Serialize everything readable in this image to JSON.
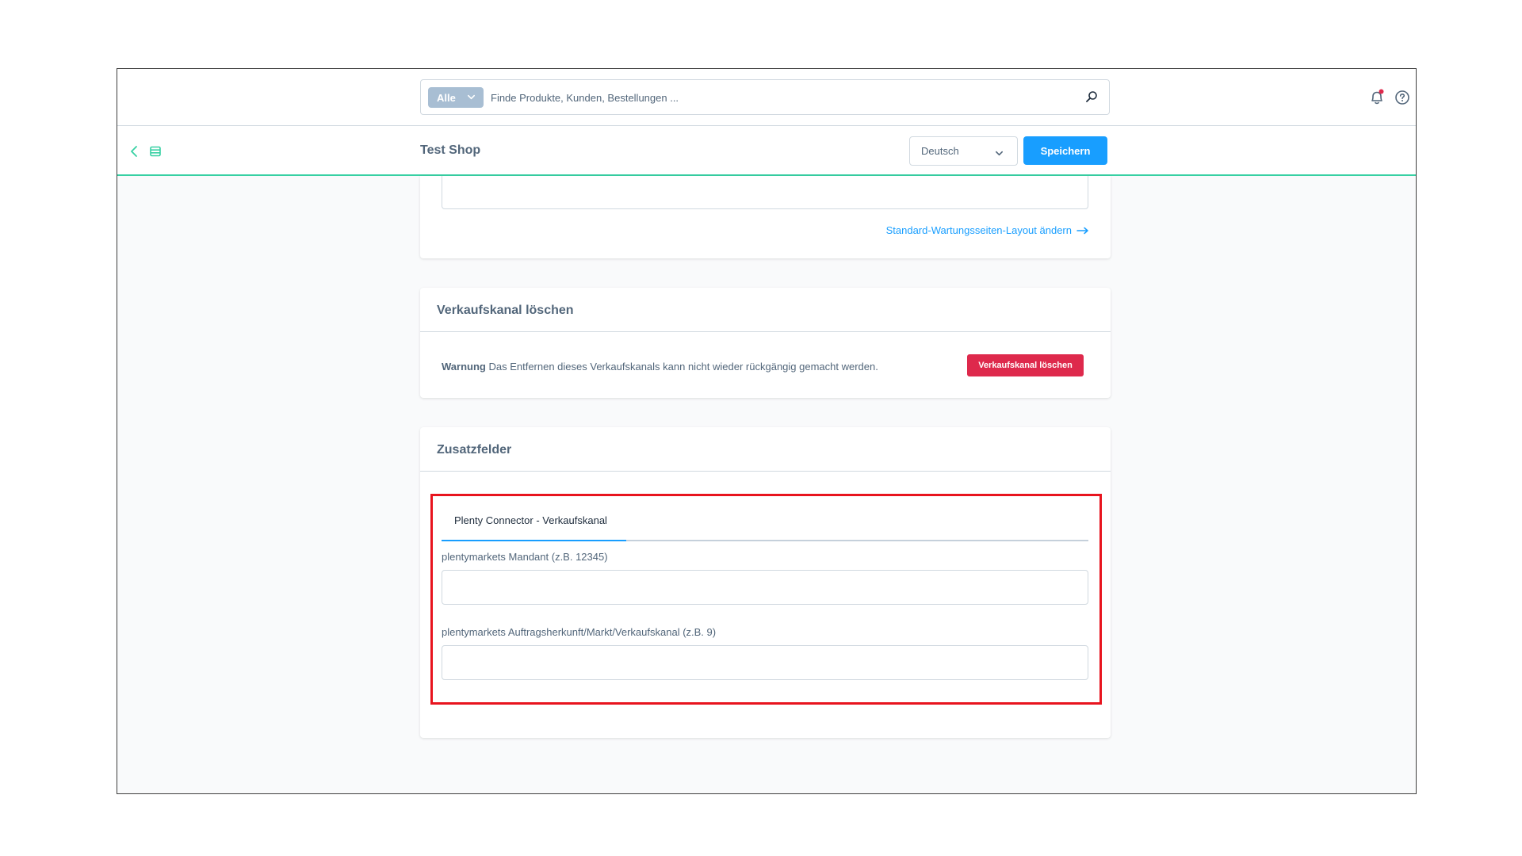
{
  "search": {
    "type_label": "Alle",
    "placeholder": "Finde Produkte, Kunden, Bestellungen ..."
  },
  "header": {
    "title": "Test Shop",
    "language": "Deutsch",
    "save_label": "Speichern"
  },
  "layout_card": {
    "link_label": "Standard-Wartungsseiten-Layout ändern"
  },
  "delete_card": {
    "title": "Verkaufskanal löschen",
    "warning_label": "Warnung",
    "warning_text": "Das Entfernen dieses Verkaufskanals kann nicht wieder rückgängig gemacht werden.",
    "button_label": "Verkaufskanal löschen"
  },
  "custom_fields_card": {
    "title": "Zusatzfelder",
    "tab_label": "Plenty Connector - Verkaufskanal",
    "fields": [
      {
        "label": "plentymarkets Mandant (z.B. 12345)",
        "value": ""
      },
      {
        "label": "plentymarkets Auftragsherkunft/Markt/Verkaufskanal (z.B. 9)",
        "value": ""
      }
    ]
  },
  "colors": {
    "primary": "#189eff",
    "danger": "#de294c",
    "accent_line": "#37d0a3",
    "highlight": "#e8141e",
    "notification_dot": "#de294c"
  },
  "icons": [
    "chevron-down-icon",
    "search-icon",
    "bell-icon",
    "help-icon",
    "back-icon",
    "list-icon",
    "arrow-right-icon"
  ]
}
